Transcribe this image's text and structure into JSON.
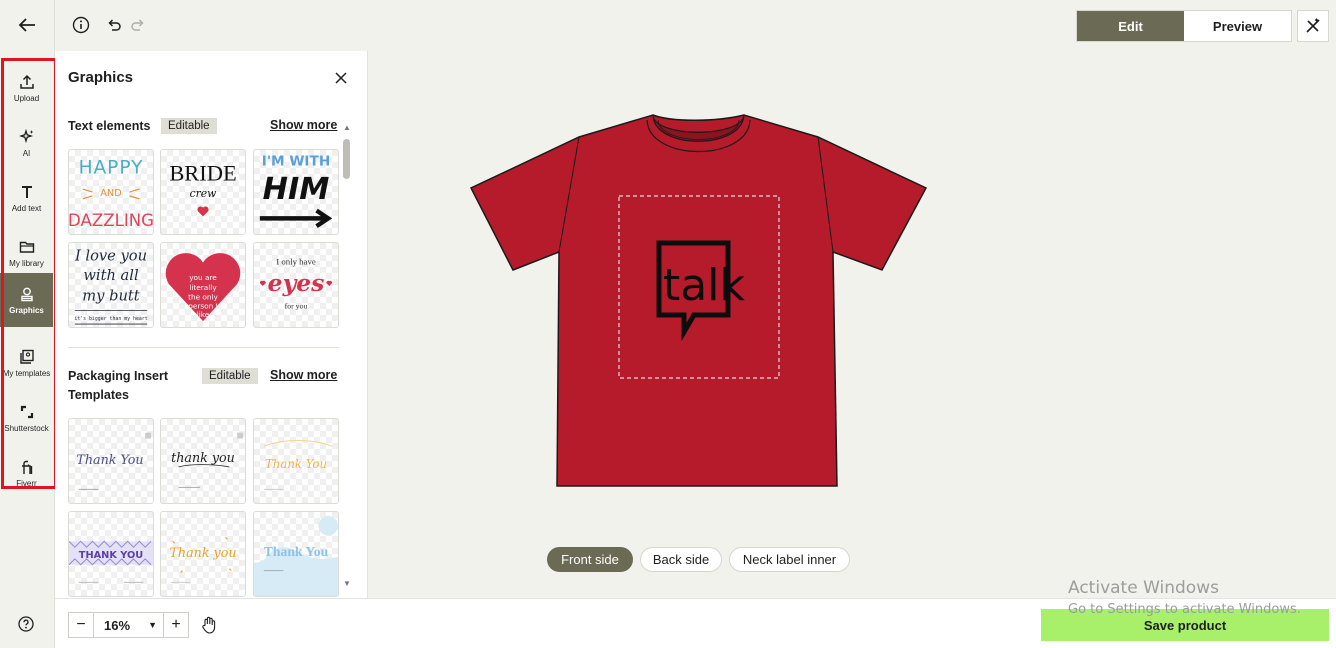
{
  "topbar": {
    "edit_label": "Edit",
    "preview_label": "Preview"
  },
  "rail": {
    "items": [
      {
        "label": "Upload",
        "icon": "upload-icon"
      },
      {
        "label": "AI",
        "icon": "sparkles-icon"
      },
      {
        "label": "Add text",
        "icon": "text-icon"
      },
      {
        "label": "My library",
        "icon": "folder-icon"
      },
      {
        "label": "Graphics",
        "icon": "shapes-icon",
        "active": true
      },
      {
        "label": "My templates",
        "icon": "templates-icon"
      },
      {
        "label": "Shutterstock",
        "icon": "shutterstock-icon"
      },
      {
        "label": "Fiverr",
        "icon": "fiverr-icon"
      }
    ]
  },
  "panel": {
    "title": "Graphics",
    "sections": [
      {
        "title": "Text elements",
        "tag": "Editable",
        "show_more": "Show more",
        "cards": [
          {
            "line1": "HAPPY",
            "line2": "AND",
            "line3": "DAZZLING"
          },
          {
            "line1": "BRIDE",
            "line2": "crew"
          },
          {
            "line1": "I'M WITH",
            "line2": "HIM"
          },
          {
            "line1": "I love you",
            "line2": "with all",
            "line3": "my butt",
            "line4": "it's bigger than my heart"
          },
          {
            "line1": "you are",
            "line2": "literally",
            "line3": "the only",
            "line4": "person I",
            "line5": "like"
          },
          {
            "line1": "I only have",
            "line2": "eyes",
            "line3": "for you"
          }
        ]
      },
      {
        "title_line1": "Packaging Insert",
        "title_line2": "Templates",
        "tag": "Editable",
        "show_more": "Show more",
        "cards": [
          {
            "text": "Thank You"
          },
          {
            "text": "thank you"
          },
          {
            "text": "Thank You"
          },
          {
            "text": "THANK YOU"
          },
          {
            "text": "Thank you"
          },
          {
            "text": "Thank You"
          }
        ]
      }
    ]
  },
  "canvas": {
    "logo_text": "talk",
    "shirt_color": "#b51b2a",
    "sides": [
      "Front side",
      "Back side",
      "Neck label inner"
    ],
    "active_side": "Front side"
  },
  "bottom": {
    "zoom": "16%",
    "save_label": "Save product"
  },
  "watermark": {
    "line1": "Activate Windows",
    "line2": "Go to Settings to activate Windows."
  },
  "colors": {
    "accent": "#6b6a55",
    "save": "#a8f06a",
    "highlight": "#e0151f"
  }
}
